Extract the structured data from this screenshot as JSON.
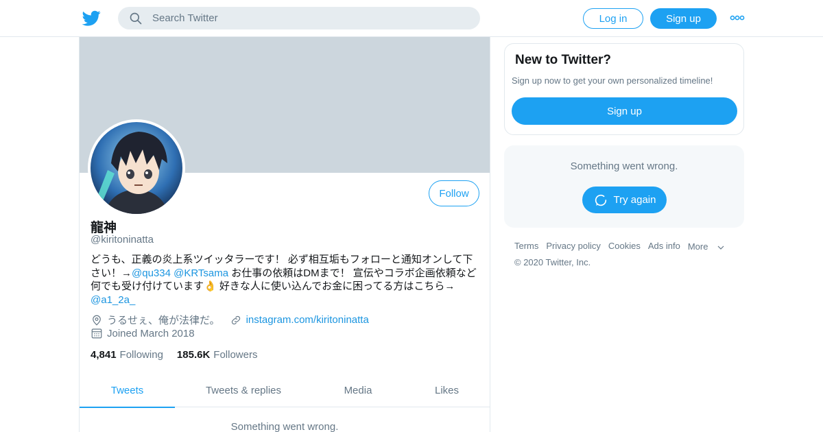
{
  "header": {
    "search_placeholder": "Search Twitter",
    "login_label": "Log in",
    "signup_label": "Sign up",
    "brand_color": "#1da1f2"
  },
  "profile": {
    "display_name": "龍神",
    "handle": "@kiritoninatta",
    "follow_label": "Follow",
    "bio": {
      "text_1": "どうも、正義の炎上系ツイッタラーです！ 必ず相互垢もフォローと通知オンして下さい！→",
      "mention_1": "@qu334",
      "mention_2": "@KRTsama",
      "text_2": " お仕事の依頼はDMまで！ 宣伝やコラボ企画依頼など何でも受け付けています👌 好きな人に使い込んでお金に困ってる方はこちら→",
      "mention_3": "@a1_2a_"
    },
    "location": "うるせぇ、俺が法律だ。",
    "website": "instagram.com/kiritoninatta",
    "joined": "Joined March 2018",
    "following_count": "4,841",
    "following_label": "Following",
    "followers_count": "185.6K",
    "followers_label": "Followers",
    "banner_color": "#ccd6dd"
  },
  "tabs": [
    {
      "label": "Tweets",
      "active": true
    },
    {
      "label": "Tweets & replies",
      "active": false
    },
    {
      "label": "Media",
      "active": false
    },
    {
      "label": "Likes",
      "active": false
    }
  ],
  "main_error": "Something went wrong.",
  "sidebar": {
    "new_title": "New to Twitter?",
    "new_sub": "Sign up now to get your own personalized timeline!",
    "new_button": "Sign up",
    "error_msg": "Something went wrong.",
    "retry_label": "Try again"
  },
  "footer": {
    "links": [
      "Terms",
      "Privacy policy",
      "Cookies",
      "Ads info",
      "More"
    ],
    "copyright": "© 2020 Twitter, Inc."
  },
  "icons": [
    "twitter-bird-icon",
    "search-icon",
    "more-dots-icon",
    "location-pin-icon",
    "link-icon",
    "calendar-icon",
    "retry-icon",
    "chevron-down-icon"
  ]
}
